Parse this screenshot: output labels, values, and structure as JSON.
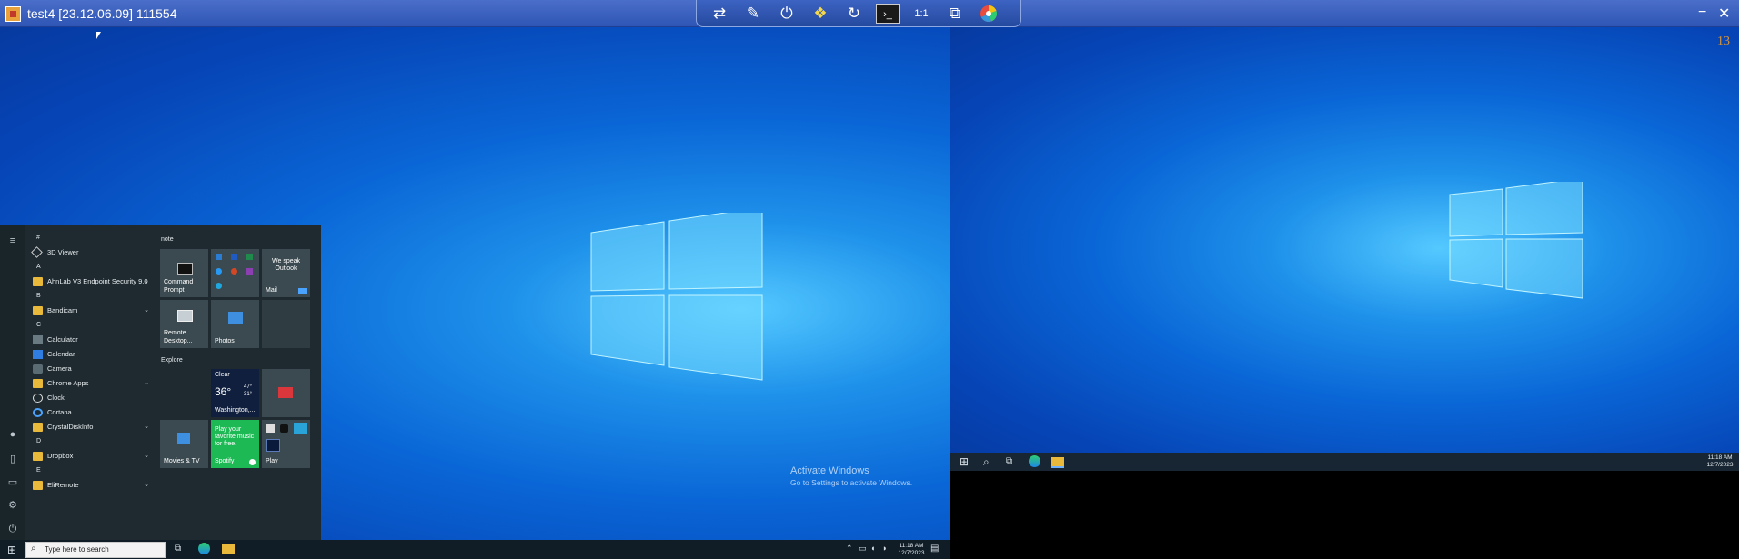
{
  "titlebar": {
    "title": "test4 [23.12.06.09] 111554",
    "minimize": "−",
    "close": "✕"
  },
  "toolbar": {
    "buttons": [
      {
        "name": "swap-arrows-icon",
        "glyph": "⇄"
      },
      {
        "name": "pen-icon",
        "glyph": "✎"
      },
      {
        "name": "power-icon",
        "glyph": "⏻"
      },
      {
        "name": "windows-flag-icon",
        "glyph": "❖"
      },
      {
        "name": "refresh-icon",
        "glyph": "↻"
      },
      {
        "name": "terminal-icon",
        "glyph": "›_"
      },
      {
        "name": "actual-size-icon",
        "glyph": "1:1"
      },
      {
        "name": "multi-monitor-icon",
        "glyph": "⧉"
      },
      {
        "name": "color-wheel-icon",
        "glyph": "●"
      }
    ]
  },
  "right_monitor": {
    "number": "13",
    "clock_time": "11:18 AM",
    "clock_date": "12/7/2023"
  },
  "desktop": {
    "activate_title": "Activate Windows",
    "activate_sub": "Go to Settings to activate Windows."
  },
  "startmenu": {
    "letters": {
      "hash": "#",
      "a": "A",
      "b": "B",
      "c": "C",
      "d": "D",
      "e": "E"
    },
    "apps": {
      "viewer3d": "3D Viewer",
      "ahnlab": "AhnLab V3 Endpoint Security 9.0",
      "bandicam": "Bandicam",
      "calculator": "Calculator",
      "calendar": "Calendar",
      "camera": "Camera",
      "chrome_apps": "Chrome Apps",
      "clock": "Clock",
      "cortana": "Cortana",
      "crystaldiskinfo": "CrystalDiskInfo",
      "dropbox": "Dropbox",
      "eliremote": "EliRemote"
    },
    "groups": {
      "note": "note",
      "explore": "Explore"
    },
    "tiles": {
      "cmd": "Command Prompt",
      "outlook": "We speak Outlook",
      "mail": "Mail",
      "remote": "Remote Desktop...",
      "photos": "Photos",
      "weather_cond": "Clear",
      "weather_temp": "36°",
      "weather_hi": "47°",
      "weather_lo": "31°",
      "weather_loc": "Washington,...",
      "movies": "Movies & TV",
      "spotify_msg": "Play your favorite music for free.",
      "spotify": "Spotify",
      "play": "Play"
    }
  },
  "taskbar": {
    "search_placeholder": "Type here to search",
    "clock_time": "11:18 AM",
    "clock_date": "12/7/2023"
  }
}
